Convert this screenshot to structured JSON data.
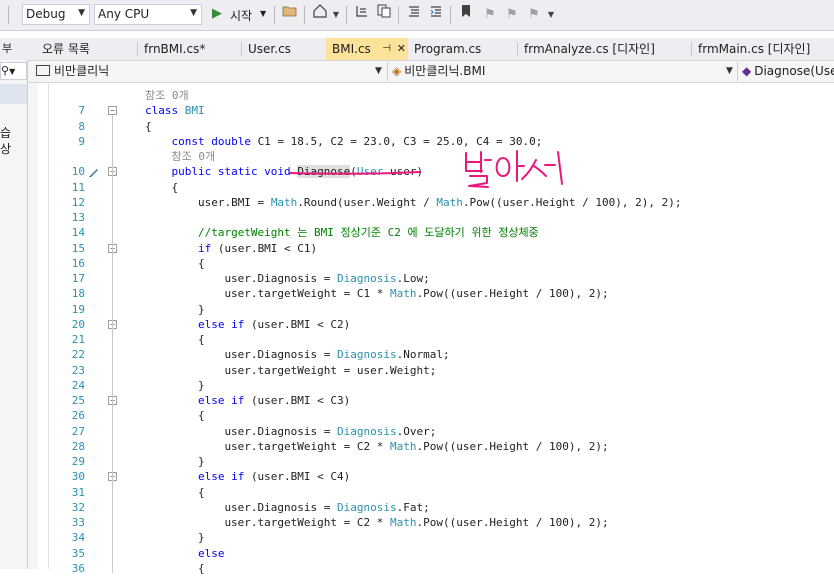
{
  "toolbar": {
    "config": "Debug",
    "platform": "Any CPU",
    "start_label": "시작"
  },
  "left_panel": {
    "top_label": "부",
    "search_icon_glyph": "⚲",
    "text1": "습",
    "text2": "상"
  },
  "tabs": [
    {
      "label": "오류 목록"
    },
    {
      "label": "frnBMI.cs*"
    },
    {
      "label": "User.cs"
    },
    {
      "label": "BMI.cs"
    },
    {
      "label": "Program.cs"
    },
    {
      "label": "frmAnalyze.cs [디자인]"
    },
    {
      "label": "frmMain.cs [디자인]"
    }
  ],
  "active_tab": "BMI.cs",
  "navbar": {
    "project": "비만클리닉",
    "class": "비만클리닉.BMI",
    "member": "Diagnose(User user)"
  },
  "editor": {
    "lines": [
      {
        "num": "",
        "tokens": [
          {
            "t": "ref",
            "v": "참조 0개"
          }
        ]
      },
      {
        "num": "7",
        "tokens": [
          {
            "t": "kw",
            "v": "class "
          },
          {
            "t": "ty",
            "v": "BMI"
          }
        ]
      },
      {
        "num": "8",
        "tokens": [
          {
            "t": "pl",
            "v": "{"
          }
        ]
      },
      {
        "num": "9",
        "tokens": [
          {
            "t": "kw",
            "v": "const double "
          },
          {
            "t": "pl",
            "v": "C1 = 18.5, C2 = 23.0, C3 = 25.0, C4 = 30.0;"
          }
        ]
      },
      {
        "num": "",
        "tokens": [
          {
            "t": "ref",
            "v": "참조 0개"
          }
        ]
      },
      {
        "num": "10",
        "tokens": [
          {
            "t": "kw",
            "v": "public static void "
          },
          {
            "t": "hl",
            "v": "Diagnose"
          },
          {
            "t": "pl",
            "v": "("
          },
          {
            "t": "ty",
            "v": "User"
          },
          {
            "t": "pl",
            "v": " user)"
          }
        ]
      },
      {
        "num": "11",
        "tokens": [
          {
            "t": "pl",
            "v": "{"
          }
        ]
      },
      {
        "num": "12",
        "tokens": [
          {
            "t": "pl",
            "v": "user.BMI = "
          },
          {
            "t": "ty",
            "v": "Math"
          },
          {
            "t": "pl",
            "v": ".Round(user.Weight / "
          },
          {
            "t": "ty",
            "v": "Math"
          },
          {
            "t": "pl",
            "v": ".Pow((user.Height / 100), 2), 2);"
          }
        ]
      },
      {
        "num": "13",
        "tokens": []
      },
      {
        "num": "14",
        "tokens": [
          {
            "t": "cm",
            "v": "//targetWeight 는 BMI 정상기준 C2 에 도달하기 위한 정상체중"
          }
        ]
      },
      {
        "num": "15",
        "tokens": [
          {
            "t": "kw",
            "v": "if "
          },
          {
            "t": "pl",
            "v": "(user.BMI < C1)"
          }
        ]
      },
      {
        "num": "16",
        "tokens": [
          {
            "t": "pl",
            "v": "{"
          }
        ]
      },
      {
        "num": "17",
        "tokens": [
          {
            "t": "pl",
            "v": "user.Diagnosis = "
          },
          {
            "t": "ty",
            "v": "Diagnosis"
          },
          {
            "t": "pl",
            "v": ".Low;"
          }
        ]
      },
      {
        "num": "18",
        "tokens": [
          {
            "t": "pl",
            "v": "user.targetWeight = C1 * "
          },
          {
            "t": "ty",
            "v": "Math"
          },
          {
            "t": "pl",
            "v": ".Pow((user.Height / 100), 2);"
          }
        ]
      },
      {
        "num": "19",
        "tokens": [
          {
            "t": "pl",
            "v": "}"
          }
        ]
      },
      {
        "num": "20",
        "tokens": [
          {
            "t": "kw",
            "v": "else if "
          },
          {
            "t": "pl",
            "v": "(user.BMI < C2)"
          }
        ]
      },
      {
        "num": "21",
        "tokens": [
          {
            "t": "pl",
            "v": "{"
          }
        ]
      },
      {
        "num": "22",
        "tokens": [
          {
            "t": "pl",
            "v": "user.Diagnosis = "
          },
          {
            "t": "ty",
            "v": "Diagnosis"
          },
          {
            "t": "pl",
            "v": ".Normal;"
          }
        ]
      },
      {
        "num": "23",
        "tokens": [
          {
            "t": "pl",
            "v": "user.targetWeight = user.Weight;"
          }
        ]
      },
      {
        "num": "24",
        "tokens": [
          {
            "t": "pl",
            "v": "}"
          }
        ]
      },
      {
        "num": "25",
        "tokens": [
          {
            "t": "kw",
            "v": "else if "
          },
          {
            "t": "pl",
            "v": "(user.BMI < C3)"
          }
        ]
      },
      {
        "num": "26",
        "tokens": [
          {
            "t": "pl",
            "v": "{"
          }
        ]
      },
      {
        "num": "27",
        "tokens": [
          {
            "t": "pl",
            "v": "user.Diagnosis = "
          },
          {
            "t": "ty",
            "v": "Diagnosis"
          },
          {
            "t": "pl",
            "v": ".Over;"
          }
        ]
      },
      {
        "num": "28",
        "tokens": [
          {
            "t": "pl",
            "v": "user.targetWeight = C2 * "
          },
          {
            "t": "ty",
            "v": "Math"
          },
          {
            "t": "pl",
            "v": ".Pow((user.Height / 100), 2);"
          }
        ]
      },
      {
        "num": "29",
        "tokens": [
          {
            "t": "pl",
            "v": "}"
          }
        ]
      },
      {
        "num": "30",
        "tokens": [
          {
            "t": "kw",
            "v": "else if "
          },
          {
            "t": "pl",
            "v": "(user.BMI < C4)"
          }
        ]
      },
      {
        "num": "31",
        "tokens": [
          {
            "t": "pl",
            "v": "{"
          }
        ]
      },
      {
        "num": "32",
        "tokens": [
          {
            "t": "pl",
            "v": "user.Diagnosis = "
          },
          {
            "t": "ty",
            "v": "Diagnosis"
          },
          {
            "t": "pl",
            "v": ".Fat;"
          }
        ]
      },
      {
        "num": "33",
        "tokens": [
          {
            "t": "pl",
            "v": "user.targetWeight = C2 * "
          },
          {
            "t": "ty",
            "v": "Math"
          },
          {
            "t": "pl",
            "v": ".Pow((user.Height / 100), 2);"
          }
        ]
      },
      {
        "num": "34",
        "tokens": [
          {
            "t": "pl",
            "v": "}"
          }
        ]
      },
      {
        "num": "35",
        "tokens": [
          {
            "t": "kw",
            "v": "else"
          }
        ]
      },
      {
        "num": "36",
        "tokens": [
          {
            "t": "pl",
            "v": "{"
          }
        ]
      }
    ]
  },
  "annotation": {
    "text": "받아서",
    "color": "#e8197a"
  }
}
